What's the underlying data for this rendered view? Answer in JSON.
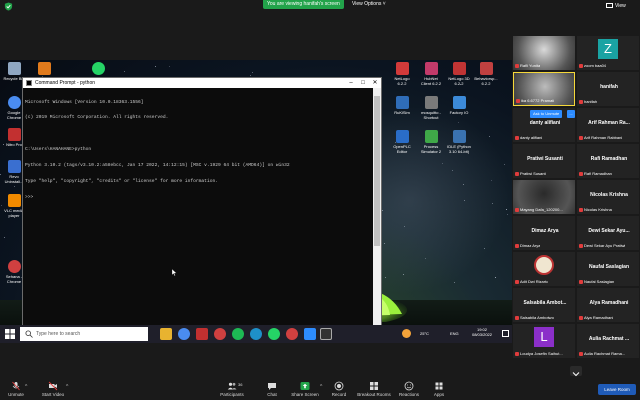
{
  "meeting": {
    "banner": "You are viewing hanifah's screen",
    "view_options": "View Options",
    "view_toggle": "View"
  },
  "desktop_icons": [
    {
      "key": "recycle",
      "label": "Recycle Bin",
      "color": "#8fa7c2"
    },
    {
      "key": "fluid",
      "label": "",
      "color": "#e07a1c"
    },
    {
      "key": "whatsapp",
      "label": "",
      "color": "#25d366"
    },
    {
      "key": "chrome",
      "label": "Google Chrome",
      "color": "#4a8cf0"
    },
    {
      "key": "nitro",
      "label": "Nitro Pro",
      "color": "#c23030"
    },
    {
      "key": "revo",
      "label": "Revo Uninstall...",
      "color": "#3a6fd0"
    },
    {
      "key": "vlc",
      "label": "VLC media player",
      "color": "#f08a00"
    },
    {
      "key": "sehana",
      "label": "Sehana - Chrome",
      "color": "#d04040"
    },
    {
      "key": "edge",
      "label": "Microsoft Edge",
      "color": "#1e90c8"
    },
    {
      "key": "grammarly",
      "label": "Grammarly",
      "color": "#15c39a"
    },
    {
      "key": "teams",
      "label": "Microsoft Teams",
      "color": "#5b5fc7"
    },
    {
      "key": "netlogo",
      "label": "NetLogo 6.2.2",
      "color": "#d23a3a"
    },
    {
      "key": "hubnet",
      "label": "HubNet Client 6.2.2",
      "color": "#c23a6a"
    },
    {
      "key": "netlogo3d",
      "label": "NetLogo 3D 6.2.2",
      "color": "#c03434"
    },
    {
      "key": "behaviorspace",
      "label": "Behaviorsp... 6.2.2",
      "color": "#c04040"
    },
    {
      "key": "rukisim",
      "label": "RuKiSim",
      "color": "#2f6db8"
    },
    {
      "key": "mosquitto",
      "label": "mosquitto - Shortcut",
      "color": "#7a7a7a"
    },
    {
      "key": "factoryio",
      "label": "Factory IO",
      "color": "#3c8ad8"
    },
    {
      "key": "openplc",
      "label": "OpenPLC Editor",
      "color": "#2a6dc8"
    },
    {
      "key": "process",
      "label": "Process Simulator 2",
      "color": "#3fa848"
    },
    {
      "key": "idle",
      "label": "IDLE (Python 3.10 64-bit)",
      "color": "#3a72b0"
    }
  ],
  "cmd": {
    "title": "Command Prompt - python",
    "lines": [
      "Microsoft Windows [Version 10.0.18363.1556]",
      "(c) 2019 Microsoft Corporation. All rights reserved.",
      "",
      "C:\\Users\\HANAHANE>python",
      "Python 3.10.2 (tags/v3.10.2:a58ebcc, Jan 17 2022, 14:12:15) [MSC v.1929 64 bit (AMD64)] on win32",
      "Type \"help\", \"copyright\", \"credits\" or \"license\" for more information.",
      ">>>"
    ]
  },
  "taskbar": {
    "search_placeholder": "Type here to search",
    "weather": "25°C",
    "lang": "ENG",
    "time": "19:02",
    "date": "08/03/2022"
  },
  "gallery": {
    "ask_unmute": "Ask to Unmute",
    "more": "...",
    "tiles": [
      {
        "key": "rafli",
        "big": "",
        "small": "Rafli Yunita",
        "video": true,
        "color": "#d9d9d9"
      },
      {
        "key": "zoom",
        "big": "",
        "small": "zoom baa04",
        "letter": "Z",
        "letter_bg": "#1aa3a3"
      },
      {
        "key": "ika",
        "big": "",
        "small": "ika 6.6772 Pramati",
        "video": true,
        "active": true,
        "color": "#bcbcbc"
      },
      {
        "key": "hanifah",
        "big": "hanifah",
        "small": "hanifah"
      },
      {
        "key": "danty",
        "big": "danty alifiani",
        "small": "danty alifiani"
      },
      {
        "key": "arif",
        "big": "Arif Rahman Ra...",
        "small": "Arif Rahman Rabbani"
      },
      {
        "key": "pratiwi",
        "big": "Pratiwi Susanti",
        "small": "Pratiwi Susanti"
      },
      {
        "key": "rafi",
        "big": "Rafi Ramadhan",
        "small": "Rafi Ramadhan"
      },
      {
        "key": "mayang",
        "big": "",
        "small": "Mayang Dafa_120200...",
        "video": true,
        "color": "#2a2a2a"
      },
      {
        "key": "nicolas",
        "big": "Nicolas Krishna",
        "small": "Nicolas Krishna"
      },
      {
        "key": "dimaz",
        "big": "Dimaz Arya",
        "small": "Dimaz Arya"
      },
      {
        "key": "dewi",
        "big": "Dewi Sekar Ayu...",
        "small": "Dewi Sekar Ayu Pratiwi"
      },
      {
        "key": "adit",
        "big": "",
        "small": "Adit Dwi Rizarto",
        "logo": true
      },
      {
        "key": "naufal",
        "big": "Naufal Saslagian",
        "small": "Naufal Saslagian"
      },
      {
        "key": "salsabila",
        "big": "Salsabila Ambot...",
        "small": "Salsabila Ambotwo"
      },
      {
        "key": "alya",
        "big": "Alya Ramadhani",
        "small": "Alya Ramadhani"
      },
      {
        "key": "loudya",
        "big": "",
        "small": "Loudya Josefin Saihut...",
        "letter": "L",
        "letter_bg": "#8b2fc9"
      },
      {
        "key": "aulia",
        "big": "Aulia Rachmat ...",
        "small": "Aulia Rachmat Rama..."
      }
    ]
  },
  "toolbar": {
    "unmute": "Unmute",
    "start_video": "Start Video",
    "participants": "Participants",
    "participants_count": "36",
    "chat": "Chat",
    "share_screen": "Share Screen",
    "record": "Record",
    "breakout": "Breakout Rooms",
    "reactions": "Reactions",
    "apps": "Apps",
    "leave": "Leave Room"
  },
  "colors": {
    "share_green": "#22a34a",
    "zoom_blue": "#2d8cff",
    "mute_red": "#e03c3c",
    "leave_blue": "#1f5bb8",
    "active_speaker": "#f5d83a"
  }
}
